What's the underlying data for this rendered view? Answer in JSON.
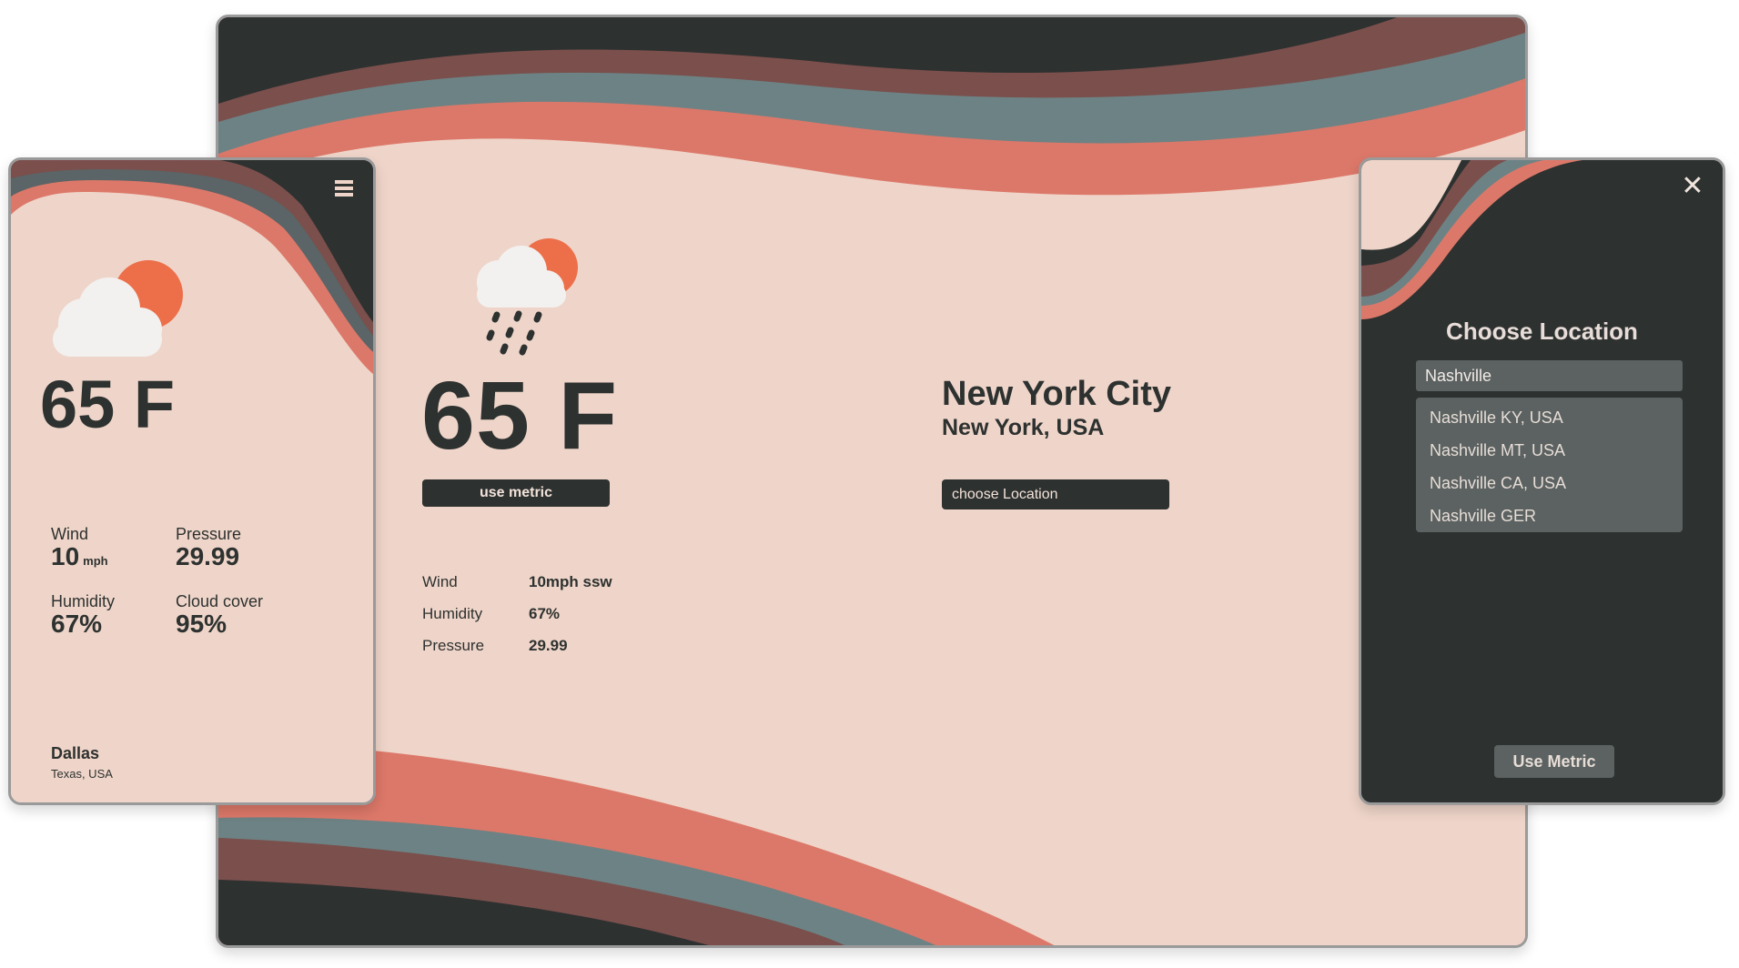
{
  "colors": {
    "peach": "#efd5c9",
    "charcoal": "#2d3130",
    "maroon": "#7a4f4c",
    "slate": "#6d8284",
    "coral": "#dc7869",
    "sun": "#ec6f4a",
    "cloud": "#f2f1ef",
    "panel_input": "#5b6261"
  },
  "desktop": {
    "temperature": "65 F",
    "metric_button": "use metric",
    "city": "New York City",
    "region": "New York, USA",
    "choose_button": "choose Location",
    "stats": [
      {
        "label": "Wind",
        "value": "10mph ssw"
      },
      {
        "label": "Humidity",
        "value": "67%"
      },
      {
        "label": "Pressure",
        "value": "29.99"
      }
    ],
    "icon": "sun-cloud-rain-icon"
  },
  "mobile": {
    "temperature": "65 F",
    "wind": {
      "label": "Wind",
      "value": "10",
      "unit": "mph"
    },
    "pressure": {
      "label": "Pressure",
      "value": "29.99"
    },
    "humidity": {
      "label": "Humidity",
      "value": "67%"
    },
    "cloud_cover": {
      "label": "Cloud cover",
      "value": "95%"
    },
    "city": "Dallas",
    "region": "Texas, USA",
    "menu_icon": "hamburger-menu-icon",
    "icon": "sun-cloud-icon"
  },
  "panel": {
    "close_icon": "close-icon",
    "title": "Choose Location",
    "search_value": "Nashville",
    "suggestions": [
      "Nashville KY, USA",
      "Nashville MT, USA",
      "Nashville CA, USA",
      "Nashville GER"
    ],
    "metric_button": "Use Metric"
  }
}
